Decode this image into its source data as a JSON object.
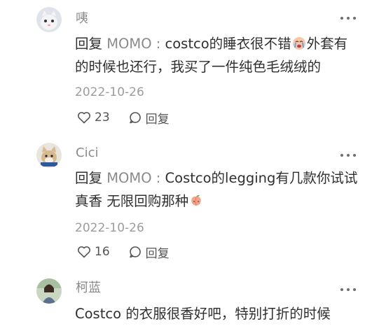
{
  "comments": [
    {
      "author": "咦",
      "reply_prefix": "回复 ",
      "mention": "MOMO",
      "separator": " : ",
      "text_before_emoji": "costco的睡衣很不错",
      "emoji": "crying-face-emoji",
      "text_after_emoji": "外套有的时候也还行，我买了一件纯色毛绒绒的",
      "date": "2022-10-26",
      "like_count": "23",
      "reply_label": "回复"
    },
    {
      "author": "Cici",
      "reply_prefix": "回复 ",
      "mention": "MOMO",
      "separator": " : ",
      "text_before_emoji": "Costco的legging有几款你试试 真香 无限回购那种",
      "emoji": "peach-emoji",
      "text_after_emoji": "",
      "date": "2022-10-26",
      "like_count": "16",
      "reply_label": "回复"
    },
    {
      "author": "柯蓝",
      "text": "Costco 的衣服很香好吧，特别打折的时候"
    }
  ],
  "colors": {
    "author": "#8a8a8a",
    "text": "#2f2f2f",
    "date": "#9c9c9c",
    "icon": "#555555"
  }
}
